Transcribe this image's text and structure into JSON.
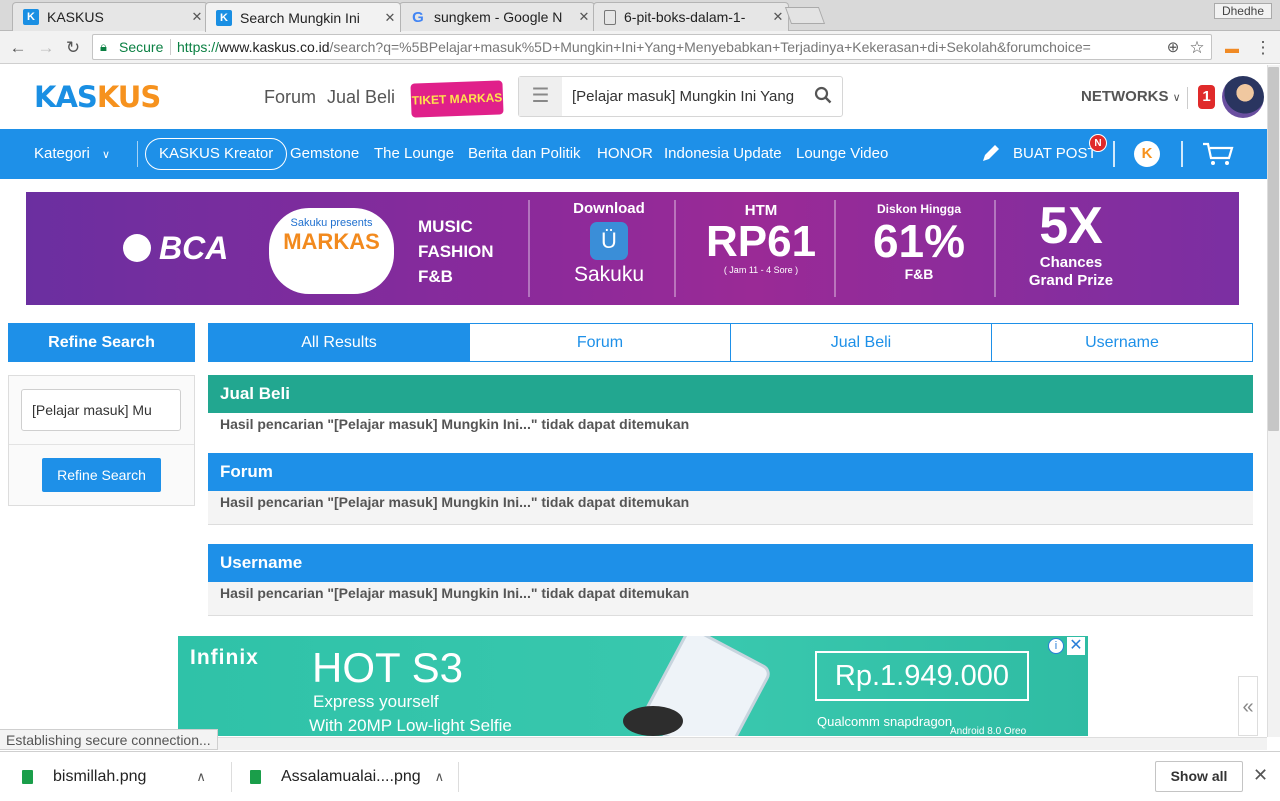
{
  "browser": {
    "tabs": [
      {
        "title": "KASKUS",
        "favicon": "kaskus-icon"
      },
      {
        "title": "Search Mungkin Ini",
        "favicon": "kaskus-icon"
      },
      {
        "title": "sungkem - Google N",
        "favicon": "google-icon"
      },
      {
        "title": "6-pit-boks-dalam-1-",
        "favicon": "page-icon"
      }
    ],
    "profile": "Dhedhe",
    "secure_label": "Secure",
    "url_scheme": "https://",
    "url_host": "www.kaskus.co.id",
    "url_path": "/search?q=%5BPelajar+masuk%5D+Mungkin+Ini+Yang+Menyebabkan+Terjadinya+Kekerasan+di+Sekolah&forumchoice="
  },
  "header": {
    "logo_part1": "KAS",
    "logo_part2": "KUS",
    "nav": [
      "Forum",
      "Jual Beli"
    ],
    "tiket_label": "TIKET MARKAS",
    "search_value": "[Pelajar masuk] Mungkin Ini Yang",
    "networks_label": "NETWORKS",
    "notif_count": "1"
  },
  "bluenav": {
    "kategori": "Kategori",
    "kreator": "KASKUS Kreator",
    "items": [
      "Gemstone",
      "The Lounge",
      "Berita dan Politik",
      "HONOR",
      "Indonesia Update",
      "Lounge Video"
    ],
    "buat_post": "BUAT POST",
    "buat_post_badge": "N"
  },
  "banner": {
    "bca": "BCA",
    "sakuku_presents": "Sakuku presents",
    "markas": "MARKAS",
    "music": "MUSIC",
    "fashion": "FASHION",
    "fnb": "F&B",
    "download": "Download",
    "sakuku": "Sakuku",
    "htm": "HTM",
    "htm_price": "RP61",
    "htm_note": "( Jam 11 - 4 Sore )",
    "diskon": "Diskon Hingga",
    "diskon_pct": "61%",
    "diskon_fnb": "F&B",
    "five_x": "5X",
    "chances": "Chances",
    "grand_prize": "Grand Prize"
  },
  "sidebar": {
    "title": "Refine Search",
    "input_value": "[Pelajar masuk] Mu",
    "button": "Refine Search"
  },
  "results": {
    "tabs": [
      "All Results",
      "Forum",
      "Jual Beli",
      "Username"
    ],
    "sections": [
      {
        "title": "Jual Beli",
        "message": "Hasil pencarian \"[Pelajar masuk] Mungkin Ini...\" tidak dapat ditemukan",
        "color": "#22a790"
      },
      {
        "title": "Forum",
        "message": "Hasil pencarian \"[Pelajar masuk] Mungkin Ini...\" tidak dapat ditemukan",
        "color": "#1e90e8"
      },
      {
        "title": "Username",
        "message": "Hasil pencarian \"[Pelajar masuk] Mungkin Ini...\" tidak dapat ditemukan",
        "color": "#1e90e8"
      }
    ]
  },
  "ad": {
    "brand": "Infinix",
    "model": "HOT S3",
    "tagline": "Express yourself",
    "feature": "With 20MP Low-light Selfie",
    "price": "Rp.1.949.000",
    "chip": "Qualcomm snapdragon",
    "os": "Android 8.0 Oreo"
  },
  "status_text": "Establishing secure connection...",
  "downloads": {
    "items": [
      "bismillah.png",
      "Assalamualai....png"
    ],
    "show_all": "Show all"
  },
  "colors": {
    "brand_blue": "#1e90e8",
    "brand_orange": "#f6921e",
    "teal": "#22a790"
  }
}
